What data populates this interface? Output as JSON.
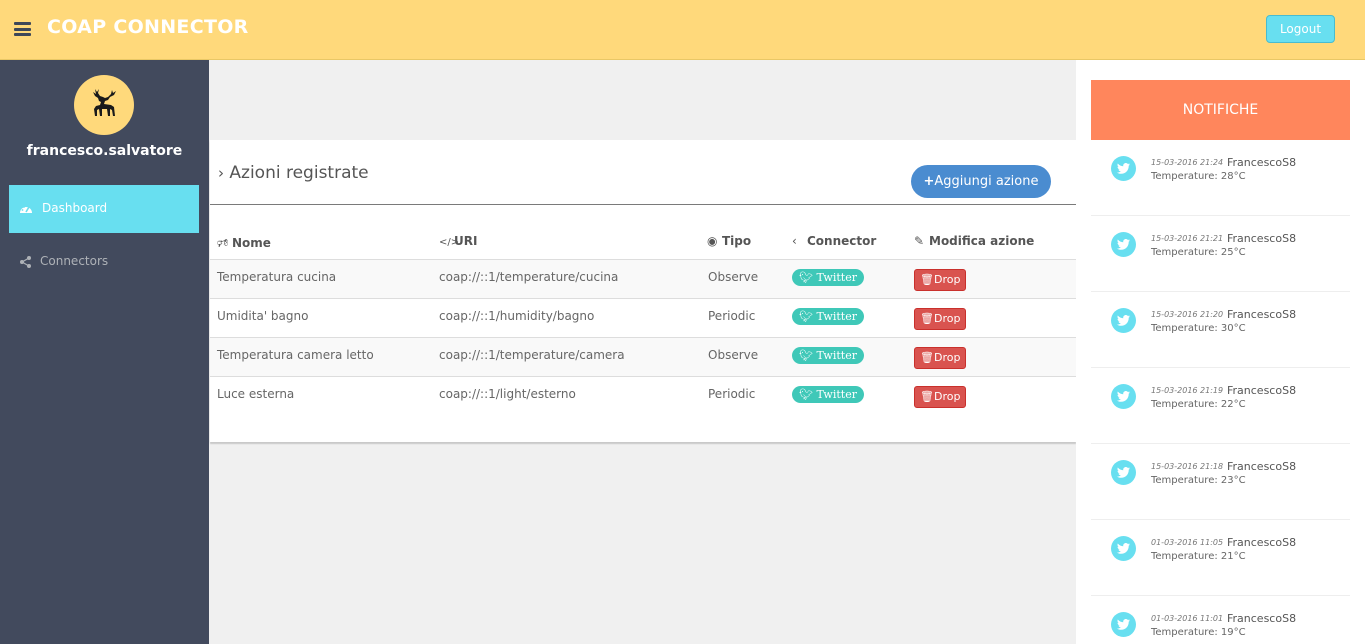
{
  "header": {
    "title": "COAP CONNECTOR",
    "logout_label": "Logout"
  },
  "sidebar": {
    "username": "francesco.salvatore",
    "items": [
      {
        "label": "Dashboard",
        "icon": "dashboard-icon",
        "active": true
      },
      {
        "label": "Connectors",
        "icon": "share-icon",
        "active": false
      }
    ]
  },
  "main": {
    "title": "Azioni registrate",
    "add_button": "Aggiungi azione",
    "columns": [
      "Nome",
      "URI",
      "Tipo",
      "Connector",
      "Modifica azione"
    ],
    "rows": [
      {
        "nome": "Temperatura cucina",
        "uri": "coap://::1/temperature/cucina",
        "tipo": "Observe",
        "connector": "Twitter",
        "action": "Drop"
      },
      {
        "nome": "Umidita' bagno",
        "uri": "coap://::1/humidity/bagno",
        "tipo": "Periodic",
        "connector": "Twitter",
        "action": "Drop"
      },
      {
        "nome": "Temperatura camera letto",
        "uri": "coap://::1/temperature/camera",
        "tipo": "Observe",
        "connector": "Twitter",
        "action": "Drop"
      },
      {
        "nome": "Luce esterna",
        "uri": "coap://::1/light/esterno",
        "tipo": "Periodic",
        "connector": "Twitter",
        "action": "Drop"
      }
    ]
  },
  "notifications": {
    "title": "NOTIFICHE",
    "items": [
      {
        "time": "15-03-2016 21:24",
        "user": "FrancescoS8",
        "message": "Temperature: 28°C"
      },
      {
        "time": "15-03-2016 21:21",
        "user": "FrancescoS8",
        "message": "Temperature: 25°C"
      },
      {
        "time": "15-03-2016 21:20",
        "user": "FrancescoS8",
        "message": "Temperature: 30°C"
      },
      {
        "time": "15-03-2016 21:19",
        "user": "FrancescoS8",
        "message": "Temperature: 22°C"
      },
      {
        "time": "15-03-2016 21:18",
        "user": "FrancescoS8",
        "message": "Temperature: 23°C"
      },
      {
        "time": "01-03-2016 11:05",
        "user": "FrancescoS8",
        "message": "Temperature: 21°C"
      },
      {
        "time": "01-03-2016 11:01",
        "user": "FrancescoS8",
        "message": "Temperature: 19°C"
      }
    ]
  },
  "colors": {
    "topbar": "#ffd97b",
    "sidebar": "#424a5d",
    "accent": "#68dff0",
    "notif_header": "#ff865c",
    "primary_button": "#4a8cd0",
    "danger": "#d9534f",
    "twitter_badge": "#3fc8b8"
  }
}
